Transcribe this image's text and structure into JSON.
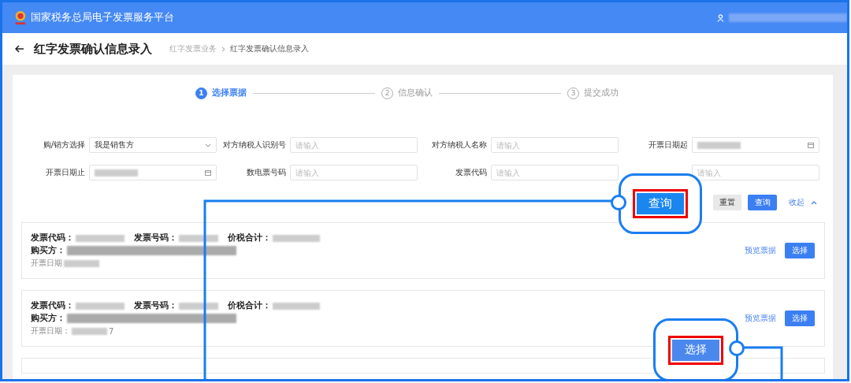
{
  "header": {
    "title": "国家税务总局电子发票服务平台"
  },
  "page": {
    "title": "红字发票确认信息录入",
    "breadcrumb": [
      "红字发票业务",
      "红字发票确认信息录入"
    ]
  },
  "steps": [
    {
      "number": "1",
      "label": "选择票据",
      "selected": true
    },
    {
      "number": "2",
      "label": "信息确认",
      "selected": false
    },
    {
      "number": "3",
      "label": "提交成功",
      "selected": false
    }
  ],
  "filters": [
    {
      "label": "购/销方选择",
      "kind": "select",
      "value": "我是销售方"
    },
    {
      "label": "对方纳税人识别号",
      "kind": "text",
      "placeholder": "请输入"
    },
    {
      "label": "对方纳税人名称",
      "kind": "text",
      "placeholder": "请输入"
    },
    {
      "label": "开票日期起",
      "kind": "date"
    },
    {
      "label": "开票日期止",
      "kind": "date"
    },
    {
      "label": "数电票号码",
      "kind": "text",
      "placeholder": "请输入"
    },
    {
      "label": "发票代码",
      "kind": "text",
      "placeholder": "请输入"
    },
    {
      "kind": "text",
      "placeholder": "请输入"
    }
  ],
  "actions": {
    "reset": "重置",
    "query": "查询",
    "collapse": "收起"
  },
  "invoices": [
    {
      "code_label": "发票代码：",
      "number_label": "发票号码：",
      "total_label": "价税合计：",
      "buyer_label": "购买方：",
      "date_label": "开票日期",
      "preview": "预览票据",
      "select": "选择"
    },
    {
      "code_label": "发票代码：",
      "number_label": "发票号码：",
      "total_label": "价税合计：",
      "buyer_label": "购买方：",
      "date_label": "开票日期：",
      "date_tail": "7",
      "preview": "预览票据",
      "select": "选择"
    }
  ],
  "callouts": [
    {
      "label": "查询"
    },
    {
      "label": "选择"
    }
  ]
}
